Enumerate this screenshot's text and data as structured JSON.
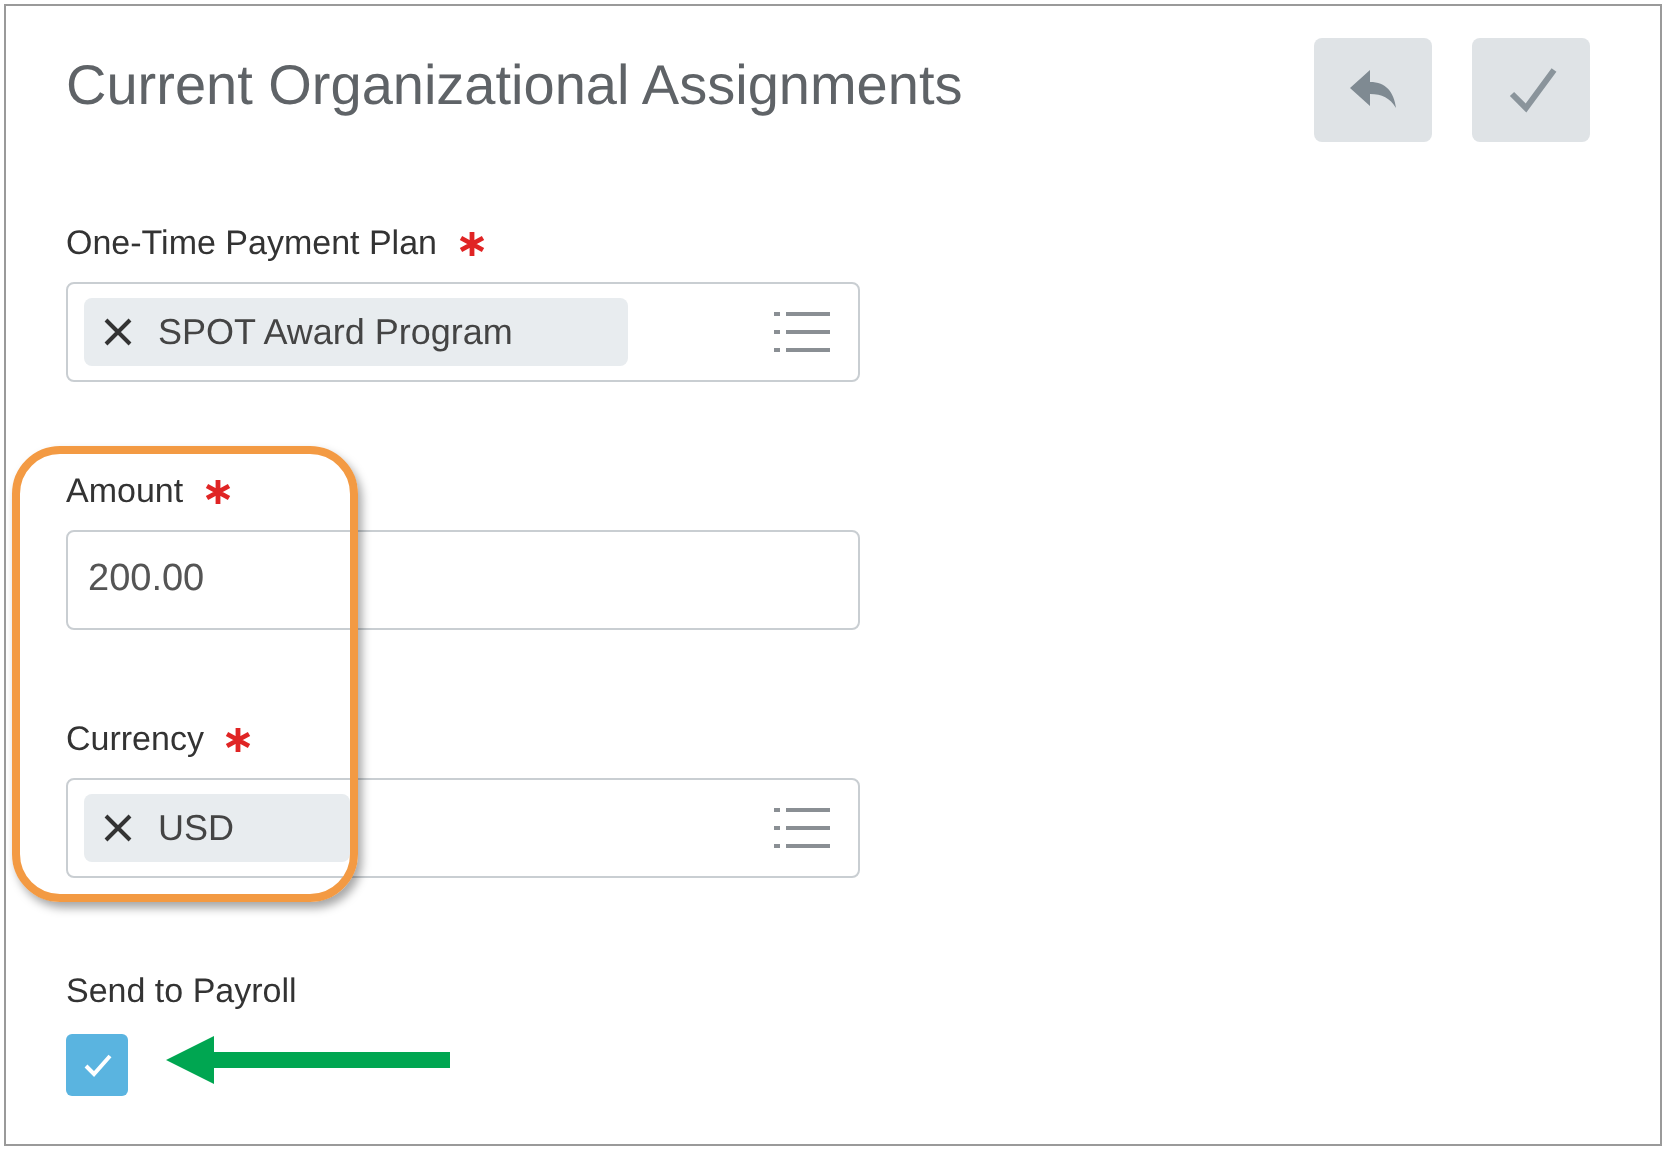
{
  "title": "Current Organizational Assignments",
  "fields": [
    {
      "kind": "multiselect",
      "label": "One-Time Payment Plan",
      "required": true,
      "value": "SPOT Award Program"
    },
    {
      "kind": "text",
      "label": "Amount",
      "required": true,
      "value": "200.00"
    },
    {
      "kind": "multiselect",
      "label": "Currency",
      "required": true,
      "value": "USD"
    }
  ],
  "checkbox": {
    "label": "Send to Payroll",
    "checked": true
  }
}
